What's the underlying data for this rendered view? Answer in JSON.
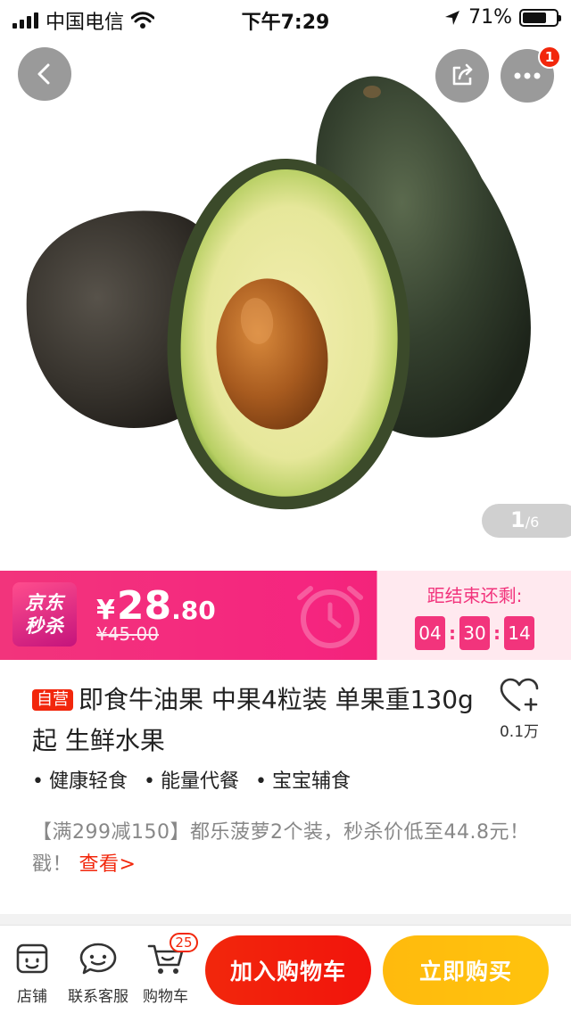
{
  "status_bar": {
    "carrier": "中国电信",
    "time": "下午7:29",
    "battery_percent": "71%",
    "battery_level": 0.71
  },
  "gallery": {
    "current": "1",
    "total": "/6",
    "more_badge": "1"
  },
  "seckill": {
    "logo_line1": "京东",
    "logo_line2": "秒杀",
    "currency": "¥",
    "price_int": "28",
    "price_dec": ".80",
    "original_price": "¥45.00",
    "countdown_label": "距结束还剩:",
    "hours": "04",
    "minutes": "30",
    "seconds": "14",
    "colors": {
      "primary": "#f2347c",
      "panel": "#ffe9ef"
    }
  },
  "product": {
    "self_tag": "自营",
    "title": "即食牛油果 中果4粒装 单果重130g起 生鲜水果",
    "favorite_count": "0.1万",
    "tags": [
      "健康轻食",
      "能量代餐",
      "宝宝辅食"
    ],
    "promo_text": "【满299减150】都乐菠萝2个装，秒杀价低至44.8元！戳！",
    "promo_link": "查看>"
  },
  "bottom_bar": {
    "shop_label": "店铺",
    "service_label": "联系客服",
    "cart_label": "购物车",
    "cart_count": "25",
    "add_to_cart": "加入购物车",
    "buy_now": "立即购买",
    "colors": {
      "cart": "#f2270c",
      "buy": "#ffbb0d"
    }
  }
}
